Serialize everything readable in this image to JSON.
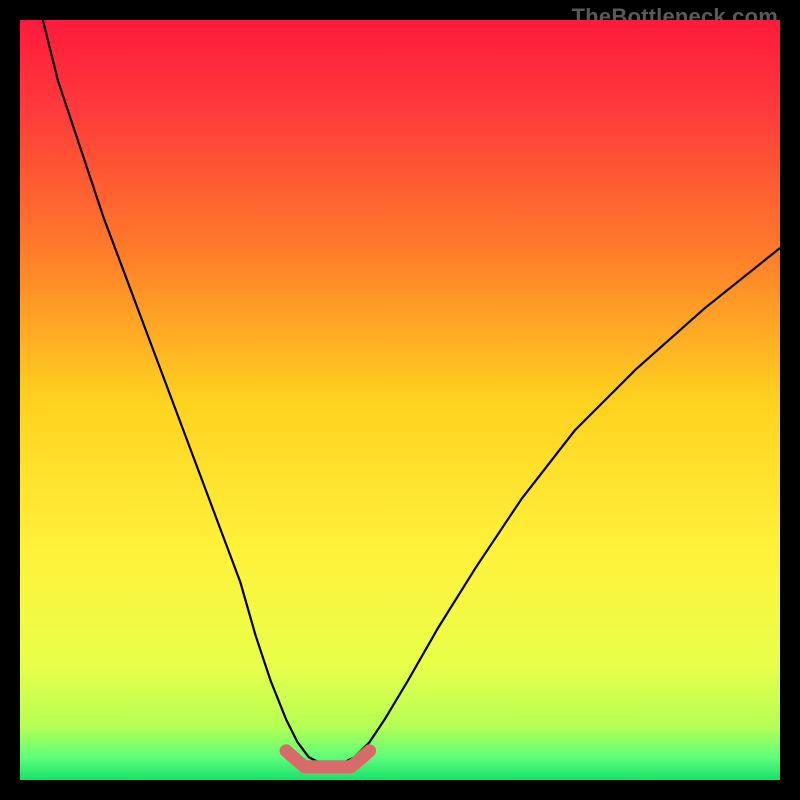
{
  "watermark": "TheBottleneck.com",
  "chart_data": {
    "type": "line",
    "title": "",
    "xlabel": "",
    "ylabel": "",
    "xlim": [
      0,
      100
    ],
    "ylim": [
      0,
      100
    ],
    "series": [
      {
        "name": "bottleneck-curve",
        "x": [
          3,
          5,
          8,
          11,
          14,
          17,
          20,
          23,
          26,
          29,
          31,
          33,
          35,
          36.5,
          38,
          40,
          42,
          44,
          46,
          48,
          51,
          55,
          60,
          66,
          73,
          81,
          90,
          100
        ],
        "y": [
          100,
          92,
          83,
          74,
          66,
          58,
          50,
          42,
          34,
          26,
          19,
          13,
          8,
          5,
          3,
          2,
          2,
          3,
          5,
          8,
          13,
          20,
          28,
          37,
          46,
          54,
          62,
          70
        ]
      }
    ],
    "annotations": [
      {
        "name": "valley-marker",
        "x_start": 35,
        "x_end": 46,
        "y": 2
      }
    ],
    "background_gradient": {
      "stops": [
        {
          "offset": 0.0,
          "color": "#ff1a3c"
        },
        {
          "offset": 0.12,
          "color": "#ff3b3b"
        },
        {
          "offset": 0.3,
          "color": "#ff7a2a"
        },
        {
          "offset": 0.5,
          "color": "#ffd21f"
        },
        {
          "offset": 0.7,
          "color": "#fff23a"
        },
        {
          "offset": 0.85,
          "color": "#e8ff4a"
        },
        {
          "offset": 0.93,
          "color": "#b4ff55"
        },
        {
          "offset": 0.97,
          "color": "#5dff7a"
        },
        {
          "offset": 1.0,
          "color": "#18e06a"
        }
      ]
    },
    "curve_color": "#000000",
    "marker_color": "#d86a6a"
  }
}
